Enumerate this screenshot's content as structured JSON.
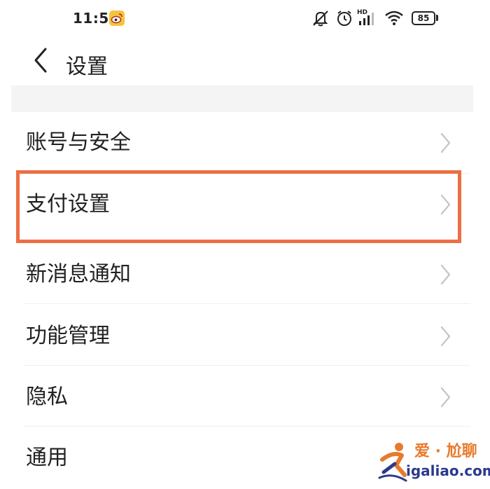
{
  "status_bar": {
    "time": "11:51",
    "battery": "85",
    "network_badge": "HD",
    "icons": [
      "weibo-notification-icon",
      "silent-bell-icon",
      "alarm-clock-icon",
      "hd-signal-icon",
      "wifi-icon",
      "battery-icon"
    ]
  },
  "header": {
    "back_icon": "chevron-left-icon",
    "title": "设置"
  },
  "menu": {
    "items": [
      {
        "label": "账号与安全"
      },
      {
        "label": "支付设置"
      },
      {
        "label": "新消息通知"
      },
      {
        "label": "功能管理"
      },
      {
        "label": "隐私"
      },
      {
        "label": "通用"
      }
    ],
    "highlighted_index": 1
  },
  "annotation": {
    "highlight_color": "#ec6f43"
  },
  "watermark": {
    "line1": "爱 · 尬聊",
    "line2": "igaliao.com",
    "colors": {
      "primary": "#e87a2d",
      "secondary": "#2b3a8c"
    }
  }
}
